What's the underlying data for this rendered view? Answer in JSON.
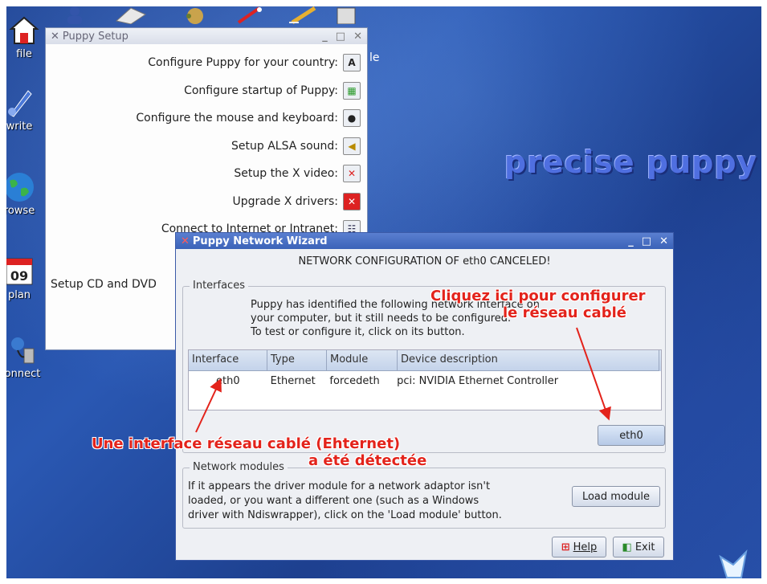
{
  "desktop": {
    "brand": "precise puppy",
    "icons": [
      {
        "label": "file"
      },
      {
        "label": "write"
      },
      {
        "label": "rowse"
      },
      {
        "label": "plan",
        "badge": "09"
      },
      {
        "label": "onnect"
      }
    ],
    "cut_label": "le"
  },
  "setup_window": {
    "title": "Puppy Setup",
    "items": [
      {
        "label": "Configure Puppy for your country:",
        "icon": "letter-a-icon"
      },
      {
        "label": "Configure startup of Puppy:",
        "icon": "chip-icon"
      },
      {
        "label": "Configure the mouse and keyboard:",
        "icon": "mouse-icon"
      },
      {
        "label": "Setup ALSA sound:",
        "icon": "speaker-icon"
      },
      {
        "label": "Setup the X video:",
        "icon": "x-video-icon"
      },
      {
        "label": "Upgrade X drivers:",
        "icon": "x-upgrade-icon"
      },
      {
        "label": "Connect to Internet or Intranet:",
        "icon": "network-icon"
      }
    ],
    "partial_item": "Setup CD and DVD"
  },
  "network_wizard": {
    "title": "Puppy Network Wizard",
    "status": "NETWORK CONFIGURATION OF eth0 CANCELED!",
    "interfaces": {
      "legend": "Interfaces",
      "intro": [
        "Puppy has identified the following network interface on",
        "your computer, but it still needs to be configured.",
        "To test or configure it, click on its button."
      ],
      "columns": [
        "Interface",
        "Type",
        "Module",
        "Device description"
      ],
      "rows": [
        {
          "interface": "eth0",
          "type": "Ethernet",
          "module": "forcedeth",
          "description": "pci:  NVIDIA Ethernet Controller"
        }
      ],
      "button": "eth0"
    },
    "modules": {
      "legend": "Network modules",
      "text": [
        "If it appears the driver module for a network adaptor isn't",
        "loaded, or you want a different one (such as a Windows",
        "driver with Ndiswrapper), click on the 'Load module' button."
      ],
      "button": "Load module"
    },
    "help_button": "Help",
    "exit_button": "Exit"
  },
  "annotations": {
    "top_right": [
      "Cliquez ici pour configurer",
      "le réseau cablé"
    ],
    "bottom_left": [
      "Une interface réseau cablé (Ehternet)",
      "a été détectée"
    ]
  },
  "colors": {
    "accent": "#3b62b8",
    "annotation": "#e3231b",
    "brand": "#4f6fe0"
  }
}
